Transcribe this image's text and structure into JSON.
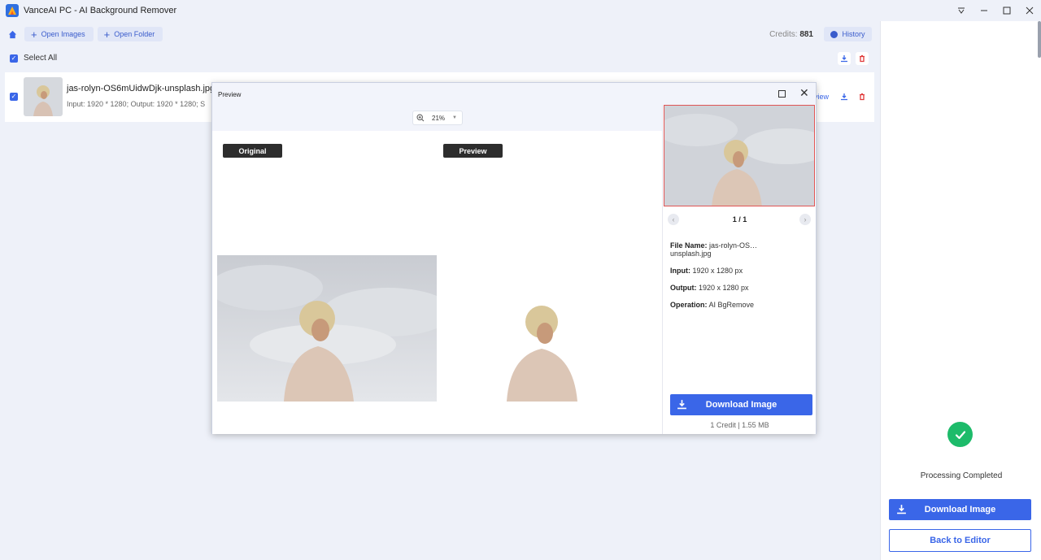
{
  "window": {
    "title": "VanceAI PC - AI Background Remover"
  },
  "toolbar": {
    "open_images_label": "Open Images",
    "open_folder_label": "Open Folder",
    "credits_label": "Credits:",
    "credits_value": "881",
    "history_label": "History"
  },
  "list": {
    "select_all_label": "Select All",
    "file": {
      "name": "jas-rolyn-OS6mUidwDjk-unsplash.jpg",
      "meta": "Input: 1920 * 1280; Output: 1920 * 1280; S",
      "preview_link": "view"
    }
  },
  "right_panel": {
    "status": "Processing Completed",
    "download_label": "Download Image",
    "back_label": "Back to Editor"
  },
  "preview_dialog": {
    "title": "Preview",
    "zoom": "21%",
    "original_tag": "Original",
    "preview_tag": "Preview",
    "pager": "1 / 1",
    "file_name_label": "File Name:",
    "file_name_value": "jas-rolyn-OS…",
    "file_name_value_line2": "unsplash.jpg",
    "input_label": "Input:",
    "input_value": "1920 x 1280 px",
    "output_label": "Output:",
    "output_value": "1920 x 1280 px",
    "operation_label": "Operation:",
    "operation_value": "AI BgRemove",
    "download_label": "Download Image",
    "credit_info": "1 Credit | 1.55 MB"
  },
  "colors": {
    "accent": "#3a66e8",
    "success": "#1dbb6a",
    "app_bg": "#eef1f9",
    "delete_red": "#e03a3a"
  }
}
